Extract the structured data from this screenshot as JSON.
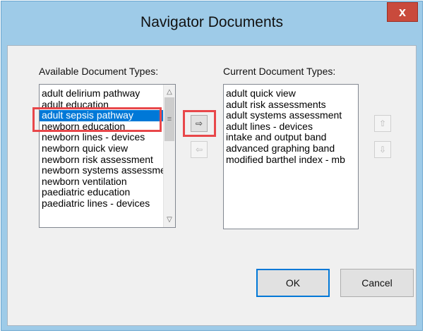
{
  "window": {
    "title": "Navigator Documents",
    "close_glyph": "x"
  },
  "available": {
    "label": "Available Document Types:",
    "items": [
      "adult delirium pathway",
      "adult education",
      "adult sepsis pathway",
      "newborn education",
      "newborn lines - devices",
      "newborn quick view",
      "newborn risk assessment",
      "newborn systems assessment",
      "newborn ventilation",
      "paediatric education",
      "paediatric lines - devices"
    ],
    "selected_index": 2
  },
  "current": {
    "label": "Current Document Types:",
    "items": [
      "adult quick view",
      "adult risk assessments",
      "adult systems assessment",
      "adult lines - devices",
      "intake and output band",
      "advanced graphing band",
      "modified barthel index - mb"
    ]
  },
  "buttons": {
    "ok": "OK",
    "cancel": "Cancel",
    "add_icon": "arrow-right-icon",
    "remove_icon": "arrow-left-icon",
    "up_icon": "arrow-up-icon",
    "down_icon": "arrow-down-icon"
  },
  "colors": {
    "highlight": "#e8474a",
    "selection": "#0078d7",
    "titlebar": "#9ecbe8"
  }
}
